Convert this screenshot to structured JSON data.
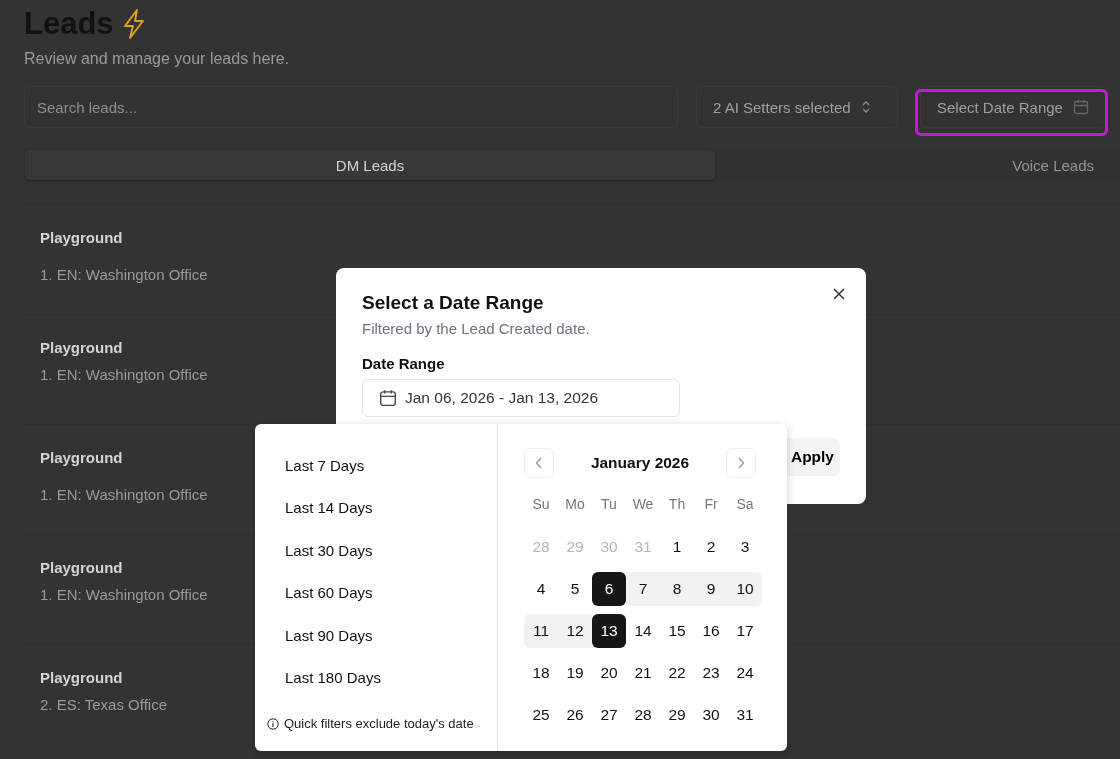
{
  "page": {
    "title": "Leads",
    "subtitle": "Review and manage your leads here."
  },
  "search": {
    "placeholder": "Search leads..."
  },
  "setter_select": {
    "value": "2 AI Setters selected"
  },
  "date_button": {
    "label": "Select Date Range",
    "highlighted": true
  },
  "tabs": [
    {
      "label": "DM Leads",
      "selected": true
    },
    {
      "label": "Voice Leads",
      "selected": false
    }
  ],
  "leads": [
    {
      "name": "Playground",
      "setter": "1. EN: Washington Office"
    },
    {
      "name": "Playground",
      "setter": "1. EN: Washington Office"
    },
    {
      "name": "Playground",
      "setter": "1. EN: Washington Office"
    },
    {
      "name": "Playground",
      "setter": "1. EN: Washington Office"
    },
    {
      "name": "Playground",
      "setter": "2. ES: Texas Office"
    }
  ],
  "dialog": {
    "title": "Select a Date Range",
    "description": "Filtered by the Lead Created date.",
    "field_label": "Date Range",
    "field_value": "Jan 06, 2026 - Jan 13, 2026",
    "apply": "Apply"
  },
  "presets": [
    "Last 7 Days",
    "Last 14 Days",
    "Last 30 Days",
    "Last 60 Days",
    "Last 90 Days",
    "Last 180 Days"
  ],
  "note": "Quick filters exclude today's date",
  "calendar": {
    "month": "January 2026",
    "weekdays": [
      "Su",
      "Mo",
      "Tu",
      "We",
      "Th",
      "Fr",
      "Sa"
    ],
    "weeks": [
      [
        {
          "label": "28",
          "outside": true,
          "selected": false,
          "in_range": false
        },
        {
          "label": "29",
          "outside": true,
          "selected": false,
          "in_range": false
        },
        {
          "label": "30",
          "outside": true,
          "selected": false,
          "in_range": false
        },
        {
          "label": "31",
          "outside": true,
          "selected": false,
          "in_range": false
        },
        {
          "label": "1",
          "outside": false,
          "selected": false,
          "in_range": false
        },
        {
          "label": "2",
          "outside": false,
          "selected": false,
          "in_range": false
        },
        {
          "label": "3",
          "outside": false,
          "selected": false,
          "in_range": false
        }
      ],
      [
        {
          "label": "4",
          "outside": false,
          "selected": false,
          "in_range": false
        },
        {
          "label": "5",
          "outside": false,
          "selected": false,
          "in_range": false
        },
        {
          "label": "6",
          "outside": false,
          "selected": true,
          "in_range": true
        },
        {
          "label": "7",
          "outside": false,
          "selected": false,
          "in_range": true
        },
        {
          "label": "8",
          "outside": false,
          "selected": false,
          "in_range": true
        },
        {
          "label": "9",
          "outside": false,
          "selected": false,
          "in_range": true
        },
        {
          "label": "10",
          "outside": false,
          "selected": false,
          "in_range": true
        }
      ],
      [
        {
          "label": "11",
          "outside": false,
          "selected": false,
          "in_range": true
        },
        {
          "label": "12",
          "outside": false,
          "selected": false,
          "in_range": true
        },
        {
          "label": "13",
          "outside": false,
          "selected": true,
          "in_range": true
        },
        {
          "label": "14",
          "outside": false,
          "selected": false,
          "in_range": false
        },
        {
          "label": "15",
          "outside": false,
          "selected": false,
          "in_range": false
        },
        {
          "label": "16",
          "outside": false,
          "selected": false,
          "in_range": false
        },
        {
          "label": "17",
          "outside": false,
          "selected": false,
          "in_range": false
        }
      ],
      [
        {
          "label": "18",
          "outside": false,
          "selected": false,
          "in_range": false
        },
        {
          "label": "19",
          "outside": false,
          "selected": false,
          "in_range": false
        },
        {
          "label": "20",
          "outside": false,
          "selected": false,
          "in_range": false
        },
        {
          "label": "21",
          "outside": false,
          "selected": false,
          "in_range": false
        },
        {
          "label": "22",
          "outside": false,
          "selected": false,
          "in_range": false
        },
        {
          "label": "23",
          "outside": false,
          "selected": false,
          "in_range": false
        },
        {
          "label": "24",
          "outside": false,
          "selected": false,
          "in_range": false
        }
      ],
      [
        {
          "label": "25",
          "outside": false,
          "selected": false,
          "in_range": false
        },
        {
          "label": "26",
          "outside": false,
          "selected": false,
          "in_range": false
        },
        {
          "label": "27",
          "outside": false,
          "selected": false,
          "in_range": false
        },
        {
          "label": "28",
          "outside": false,
          "selected": false,
          "in_range": false
        },
        {
          "label": "29",
          "outside": false,
          "selected": false,
          "in_range": false
        },
        {
          "label": "30",
          "outside": false,
          "selected": false,
          "in_range": false
        },
        {
          "label": "31",
          "outside": false,
          "selected": false,
          "in_range": false
        }
      ]
    ]
  }
}
